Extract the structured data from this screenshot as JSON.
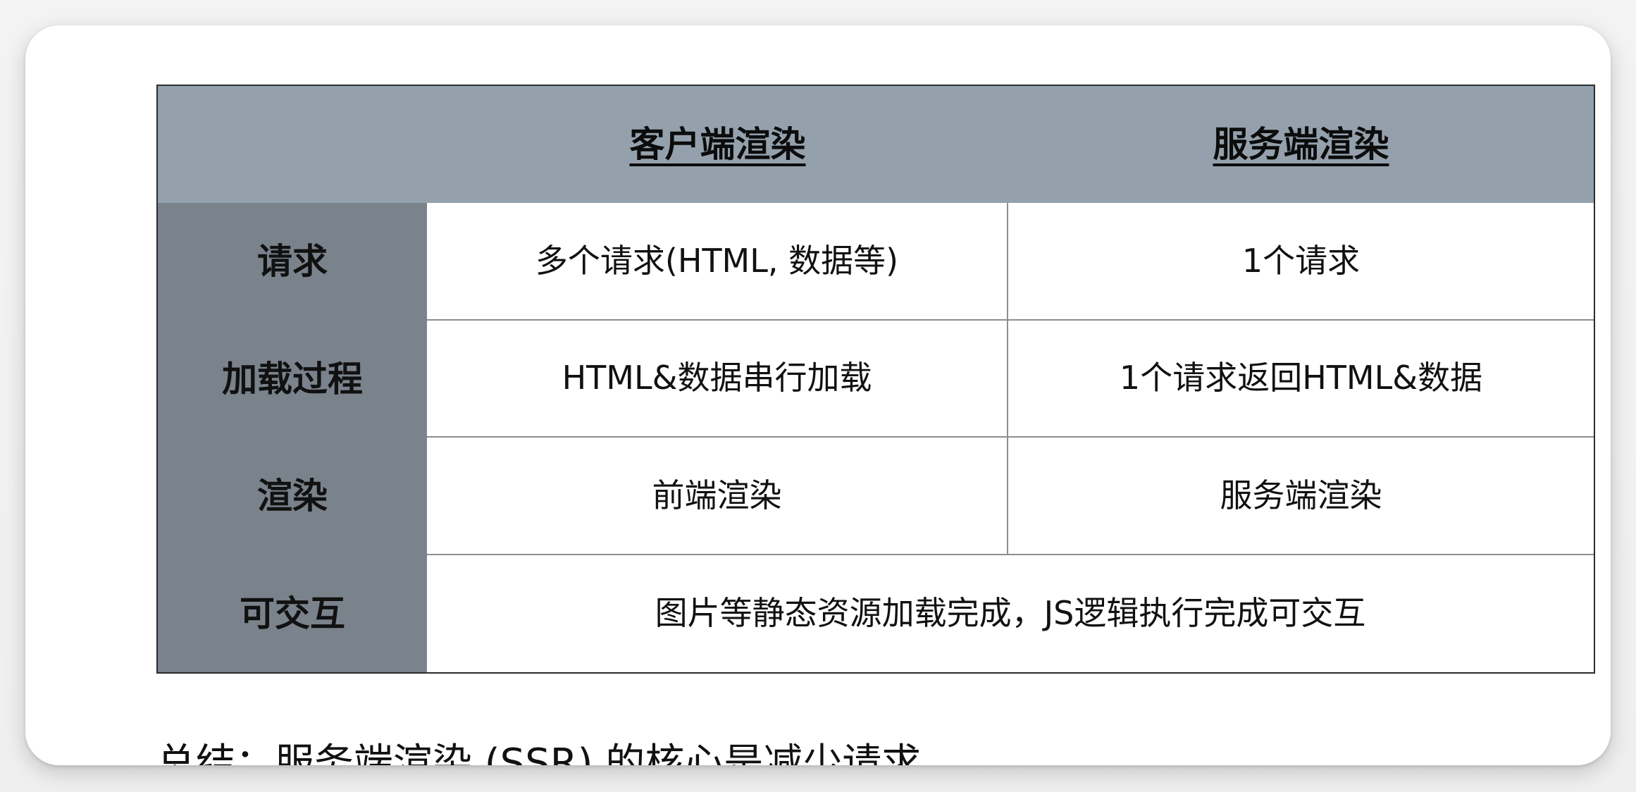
{
  "table": {
    "columns": [
      "客户端渲染",
      "服务端渲染"
    ],
    "rows": [
      {
        "label": "请求",
        "client": "多个请求(HTML, 数据等)",
        "server": "1个请求"
      },
      {
        "label": "加载过程",
        "client": "HTML&数据串行加载",
        "server": "1个请求返回HTML&数据"
      },
      {
        "label": "渲染",
        "client": "前端渲染",
        "server": "服务端渲染"
      },
      {
        "label": "可交互",
        "merged": "图片等静态资源加载完成，JS逻辑执行完成可交互"
      }
    ]
  },
  "summary": "总结：服务端渲染 (SSR) 的核心是减少请求",
  "colors": {
    "header_bg": "#94a1ad",
    "rowhead_bg": "#7a828c",
    "body_bg": "#ffffff",
    "outer_border": "#2b2b2b",
    "grid_line": "#8d8d8d"
  }
}
